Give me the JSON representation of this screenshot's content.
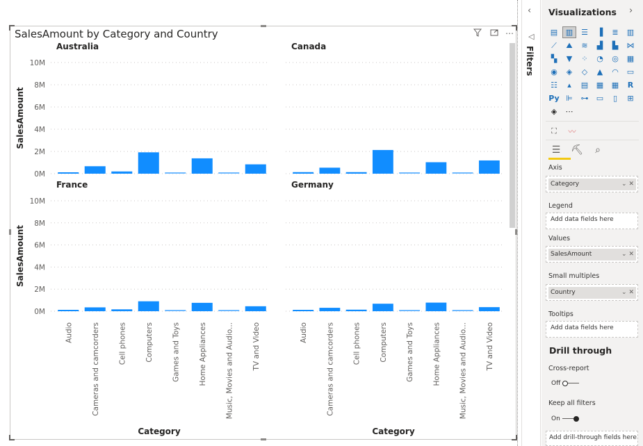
{
  "visual": {
    "title": "SalesAmount by Category and Country",
    "header_icons": [
      "filter-icon",
      "focus-mode-icon",
      "more-options-icon"
    ]
  },
  "chart_data": {
    "type": "bar",
    "title": "SalesAmount by Category and Country",
    "xlabel": "Category",
    "ylabel": "SalesAmount",
    "ylim": [
      0,
      10000000
    ],
    "yticks": [
      "0M",
      "2M",
      "4M",
      "6M",
      "8M",
      "10M"
    ],
    "ytick_values": [
      0,
      2000000,
      4000000,
      6000000,
      8000000,
      10000000
    ],
    "grid": true,
    "layout": "small-multiples 2x2",
    "categories": [
      "Audio",
      "Cameras and camcorders",
      "Cell phones",
      "Computers",
      "Games and Toys",
      "Home Appliances",
      "Music, Movies and Audio...",
      "TV and Video"
    ],
    "panels": [
      {
        "name": "Australia",
        "values": [
          120000,
          670000,
          200000,
          1920000,
          50000,
          1380000,
          50000,
          840000
        ]
      },
      {
        "name": "Canada",
        "values": [
          140000,
          540000,
          140000,
          2130000,
          40000,
          1030000,
          40000,
          1190000
        ]
      },
      {
        "name": "France",
        "values": [
          120000,
          350000,
          170000,
          900000,
          80000,
          760000,
          80000,
          450000
        ]
      },
      {
        "name": "Germany",
        "values": [
          100000,
          310000,
          140000,
          680000,
          80000,
          780000,
          80000,
          370000
        ]
      }
    ],
    "bar_color": "#118dff"
  },
  "filters": {
    "label": "Filters"
  },
  "viz_pane": {
    "title": "Visualizations",
    "icons": [
      "stacked-bar-chart",
      "stacked-column-chart",
      "clustered-bar-chart",
      "clustered-column-chart",
      "100-stacked-bar-chart",
      "100-stacked-column-chart",
      "line-chart",
      "area-chart",
      "stacked-area-chart",
      "line-clustered-column-chart",
      "line-stacked-column-chart",
      "ribbon-chart",
      "waterfall-chart",
      "funnel-chart",
      "scatter-chart",
      "pie-chart",
      "donut-chart",
      "treemap",
      "map",
      "filled-map",
      "shape-map",
      "azure-map",
      "gauge",
      "card",
      "multi-row-card",
      "kpi",
      "slicer",
      "table",
      "matrix",
      "r-visual",
      "python-visual",
      "key-influencers",
      "decomposition-tree",
      "qa",
      "smart-narrative",
      "paginated-report",
      "power-apps",
      "more-visuals"
    ],
    "icon_glyphs": [
      "▤",
      "▥",
      "☰",
      "▐",
      "≣",
      "▥",
      "⟋",
      "⛰",
      "≋",
      "▟",
      "▙",
      "⋈",
      "▚",
      "▼",
      "⁘",
      "◔",
      "◎",
      "▦",
      "◉",
      "◈",
      "◇",
      "▲",
      "◠",
      "▭",
      "☷",
      "▴",
      "▤",
      "▦",
      "▦",
      "R",
      "Py",
      "⊫",
      "⊶",
      "▭",
      "▯",
      "⊞",
      "◈",
      "⋯"
    ],
    "custom_icons": [
      "format-painter-icon",
      "line-sparkline-icon"
    ],
    "tabs": [
      "fields-tab",
      "format-tab",
      "analytics-tab"
    ],
    "wells": {
      "axis_label": "Axis",
      "axis_field": "Category",
      "legend_label": "Legend",
      "legend_placeholder": "Add data fields here",
      "values_label": "Values",
      "values_field": "SalesAmount",
      "small_multiples_label": "Small multiples",
      "small_multiples_field": "Country",
      "tooltips_label": "Tooltips",
      "tooltips_placeholder": "Add data fields here"
    },
    "drill_through": {
      "title": "Drill through",
      "cross_report_label": "Cross-report",
      "cross_report_state": "Off",
      "keep_filters_label": "Keep all filters",
      "keep_filters_state": "On",
      "placeholder": "Add drill-through fields here"
    }
  }
}
